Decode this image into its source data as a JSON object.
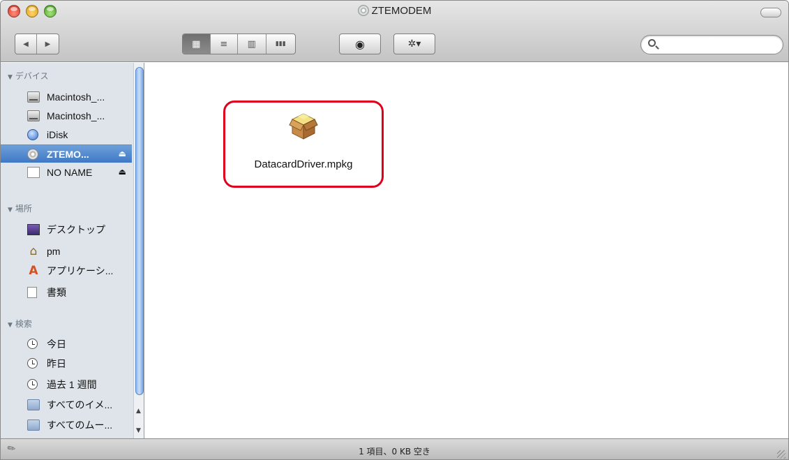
{
  "window": {
    "title": "ZTEMODEM"
  },
  "toolbar": {
    "back_icon": "◀",
    "forward_icon": "▶",
    "view_icon_label": "▦",
    "view_list_label": "≡",
    "view_column_label": "▥",
    "view_coverflow_label": "▮▮▮",
    "quicklook_label": "◉",
    "action_label": "✲▾",
    "search_placeholder": ""
  },
  "sidebar": {
    "devices_header": "デバイス",
    "places_header": "場所",
    "search_header": "検索",
    "devices": [
      {
        "label": "Macintosh_...",
        "icon": "hard-disk-icon"
      },
      {
        "label": "Macintosh_...",
        "icon": "hard-disk-icon"
      },
      {
        "label": "iDisk",
        "icon": "idisk-icon"
      },
      {
        "label": "ZTEMO...",
        "icon": "cd-disc-icon",
        "selected": true,
        "eject": "⏏"
      },
      {
        "label": "NO NAME",
        "icon": "removable-disk-icon",
        "eject": "⏏"
      }
    ],
    "places": [
      {
        "label": "デスクトップ",
        "icon": "desktop-icon"
      },
      {
        "label": "pm",
        "icon": "home-icon"
      },
      {
        "label": "アプリケーシ...",
        "icon": "applications-icon"
      },
      {
        "label": "書類",
        "icon": "documents-icon"
      }
    ],
    "searches": [
      {
        "label": "今日",
        "icon": "clock-icon"
      },
      {
        "label": "昨日",
        "icon": "clock-icon"
      },
      {
        "label": "過去 1 週間",
        "icon": "clock-icon"
      },
      {
        "label": "すべてのイメ...",
        "icon": "smart-folder-icon"
      },
      {
        "label": "すべてのムー...",
        "icon": "smart-folder-icon"
      }
    ]
  },
  "main": {
    "file_name": "DatacardDriver.mpkg",
    "highlight_color": "#e0001b"
  },
  "status": {
    "text": "1 項目、0 KB 空き"
  }
}
